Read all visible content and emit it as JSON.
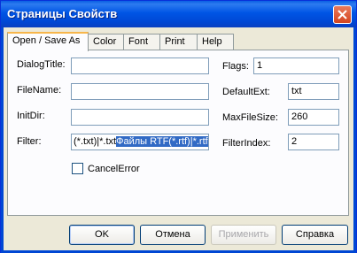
{
  "window": {
    "title": "Страницы Свойств"
  },
  "tabs": [
    {
      "label": "Open / Save As",
      "active": true
    },
    {
      "label": "Color"
    },
    {
      "label": "Font"
    },
    {
      "label": "Print"
    },
    {
      "label": "Help"
    }
  ],
  "fields": {
    "dialog_title": {
      "label": "DialogTitle:",
      "value": ""
    },
    "file_name": {
      "label": "FileName:",
      "value": ""
    },
    "init_dir": {
      "label": "InitDir:",
      "value": ""
    },
    "filter": {
      "label": "Filter:",
      "value_plain": "(*.txt)|*.txt",
      "value_selected": "Файлы RTF(*.rtf)|*.rtf"
    },
    "flags": {
      "label": "Flags:",
      "value": "1"
    },
    "default_ext": {
      "label": "DefaultExt:",
      "value": "txt"
    },
    "max_file_size": {
      "label": "MaxFileSize:",
      "value": "260"
    },
    "filter_index": {
      "label": "FilterIndex:",
      "value": "2"
    }
  },
  "cancel_error": {
    "label": "CancelError",
    "checked": false
  },
  "buttons": {
    "ok": "OK",
    "cancel": "Отмена",
    "apply": "Применить",
    "help": "Справка"
  },
  "colors": {
    "selection": "#316ac5",
    "titlebar": "#0055e5"
  }
}
